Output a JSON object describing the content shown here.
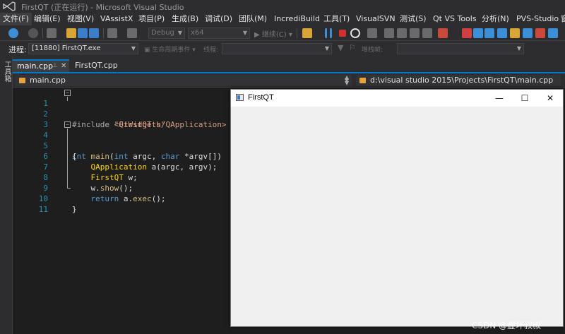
{
  "window": {
    "title": "FirstQT (正在运行) - Microsoft Visual Studio"
  },
  "menu": [
    "文件(F)",
    "编辑(E)",
    "视图(V)",
    "VAssistX",
    "项目(P)",
    "生成(B)",
    "调试(D)",
    "团队(M)",
    "IncrediBuild",
    "工具(T)",
    "VisualSVN",
    "测试(S)",
    "Qt VS Tools",
    "分析(N)",
    "PVS-Studio",
    "窗"
  ],
  "toolbar": {
    "config": "Debug",
    "platform": "x64",
    "continue_label": "继续(C)"
  },
  "process_bar": {
    "label": "进程:",
    "process_value": "[11880] FirstQT.exe",
    "lifecycle_label": "生命周期事件",
    "thread_label": "线程:",
    "stackframe_label": "堆栈帧:"
  },
  "toolbox": {
    "label": "工具箱"
  },
  "tabs": [
    {
      "label": "main.cpp",
      "active": true
    },
    {
      "label": "FirstQT.cpp",
      "active": false
    }
  ],
  "nav": {
    "scope": "main.cpp",
    "path": "d:\\visual studio 2015\\Projects\\FirstQT\\main.cpp"
  },
  "code": {
    "line_numbers": [
      "1",
      "2",
      "3",
      "4",
      "5",
      "6",
      "7",
      "8",
      "9",
      "10",
      "11"
    ],
    "l1_directive": "#include ",
    "l1_string": "\"FirstQT.h\"",
    "l2_directive": "#include ",
    "l2_string": "<QtWidgets/QApplication>",
    "l4_int": "int",
    "l4_main": "main",
    "l4_rest_a": "(",
    "l4_int2": "int",
    "l4_argc": " argc, ",
    "l4_char": "char",
    "l4_argv": " *argv[])",
    "l5": "{",
    "l6_type": "QApplication",
    "l6_rest": " a(argc, argv);",
    "l7_type": "FirstQT",
    "l7_rest": " w;",
    "l8_obj": "w.",
    "l8_fn": "show",
    "l8_rest": "();",
    "l9_kw": "return",
    "l9_obj": " a.",
    "l9_fn": "exec",
    "l9_rest": "();",
    "l10": "}"
  },
  "app_window": {
    "title": "FirstQT",
    "minimize": "—",
    "maximize": "☐",
    "close": "✕"
  },
  "watermark": "CSDN @虚坏叔叔"
}
